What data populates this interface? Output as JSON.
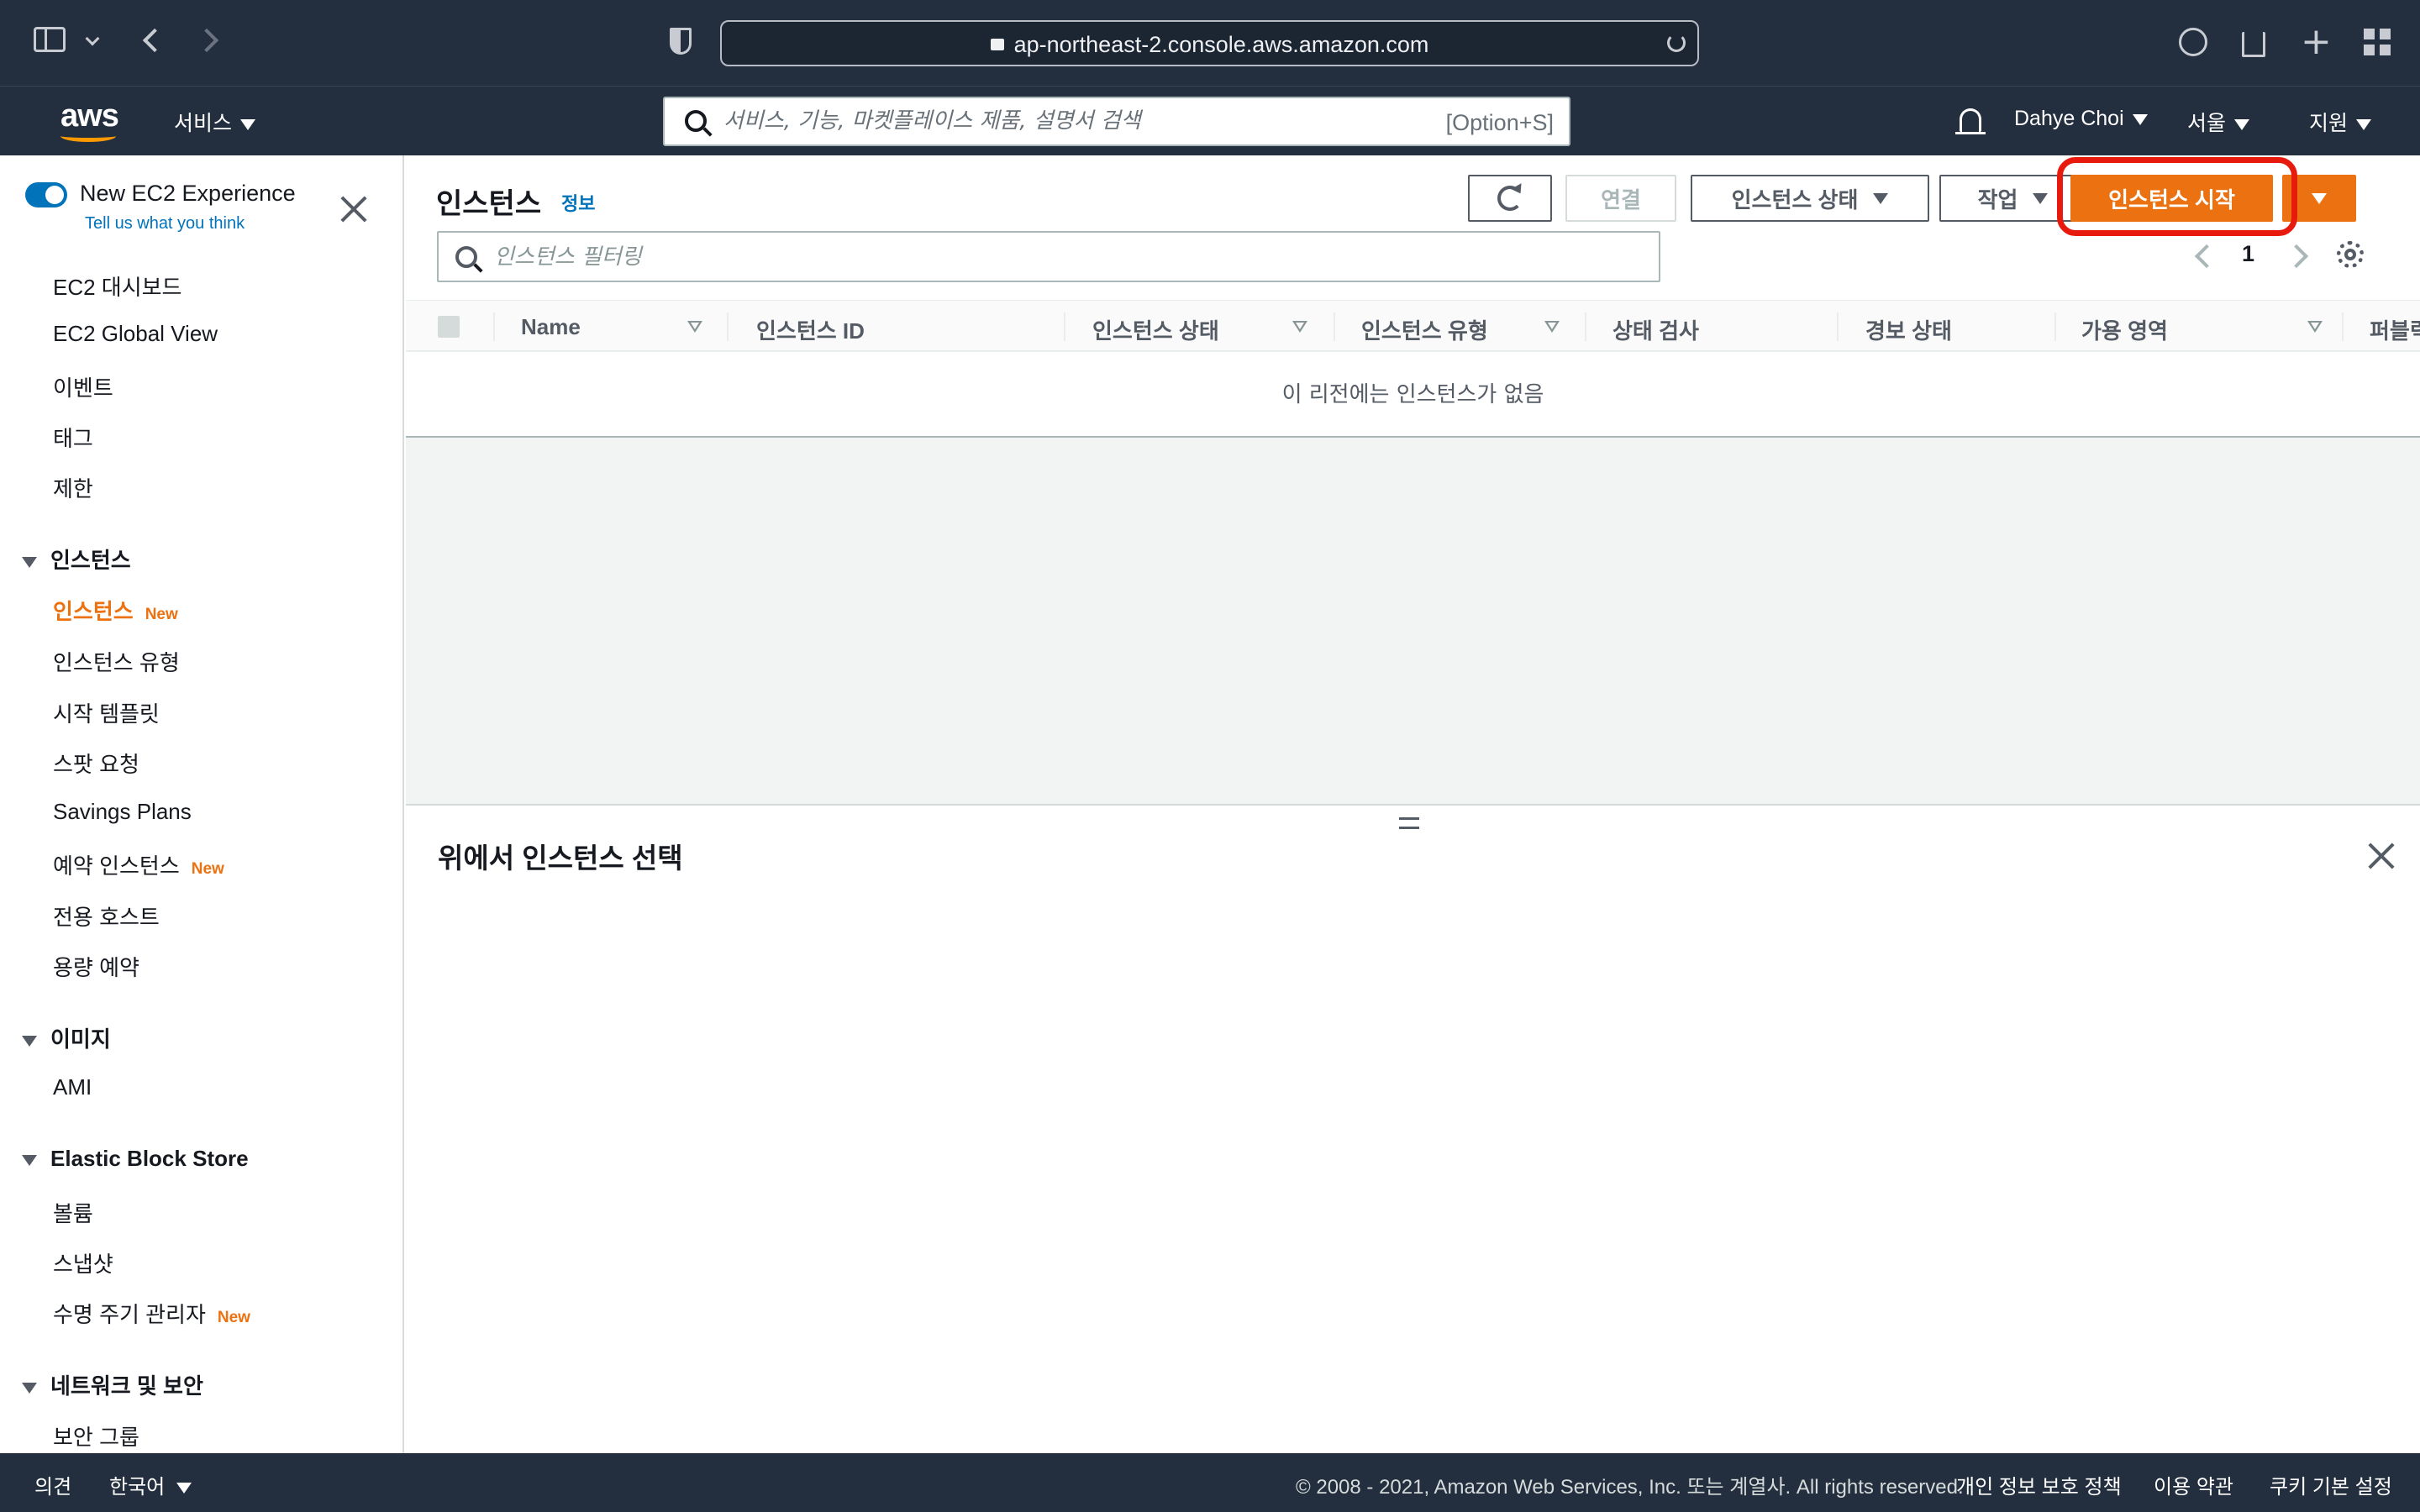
{
  "browser": {
    "url": "ap-northeast-2.console.aws.amazon.com"
  },
  "header": {
    "services_label": "서비스",
    "search_placeholder": "서비스, 기능, 마켓플레이스 제품, 설명서 검색",
    "search_shortcut": "[Option+S]",
    "user_name": "Dahye Choi",
    "region": "서울",
    "support": "지원"
  },
  "sidebar": {
    "experience_title": "New EC2 Experience",
    "experience_link": "Tell us what you think",
    "new_badge": "New",
    "top_items": [
      "EC2 대시보드",
      "EC2 Global View",
      "이벤트",
      "태그",
      "제한"
    ],
    "sections": [
      {
        "title": "인스턴스",
        "items": [
          {
            "label": "인스턴스",
            "new": true,
            "active": true
          },
          {
            "label": "인스턴스 유형"
          },
          {
            "label": "시작 템플릿"
          },
          {
            "label": "스팟 요청"
          },
          {
            "label": "Savings Plans"
          },
          {
            "label": "예약 인스턴스",
            "new": true
          },
          {
            "label": "전용 호스트"
          },
          {
            "label": "용량 예약"
          }
        ]
      },
      {
        "title": "이미지",
        "items": [
          {
            "label": "AMI"
          }
        ]
      },
      {
        "title": "Elastic Block Store",
        "items": [
          {
            "label": "볼륨"
          },
          {
            "label": "스냅샷"
          },
          {
            "label": "수명 주기 관리자",
            "new": true
          }
        ]
      },
      {
        "title": "네트워크 및 보안",
        "items": [
          {
            "label": "보안 그룹"
          }
        ]
      }
    ]
  },
  "main": {
    "title": "인스턴스",
    "info_link": "정보",
    "buttons": {
      "connect": "연결",
      "instance_state": "인스턴스 상태",
      "actions": "작업",
      "launch": "인스턴스 시작"
    },
    "filter_placeholder": "인스턴스 필터링",
    "page_number": "1",
    "columns": [
      "Name",
      "인스턴스 ID",
      "인스턴스 상태",
      "인스턴스 유형",
      "상태 검사",
      "경보 상태",
      "가용 영역",
      "퍼블릭"
    ],
    "empty_message": "이 리전에는 인스턴스가 없음",
    "split_panel_title": "위에서 인스턴스 선택"
  },
  "footer": {
    "feedback": "의견",
    "language": "한국어",
    "copyright": "© 2008 - 2021, Amazon Web Services, Inc. 또는 계열사. All rights reserved.",
    "privacy": "개인 정보 보호 정책",
    "terms": "이용 약관",
    "cookies": "쿠키 기본 설정"
  },
  "colors": {
    "header_bg": "#232f3e",
    "accent_orange": "#ec7211",
    "link_blue": "#0073bb",
    "highlight_red": "#e81a0e"
  }
}
